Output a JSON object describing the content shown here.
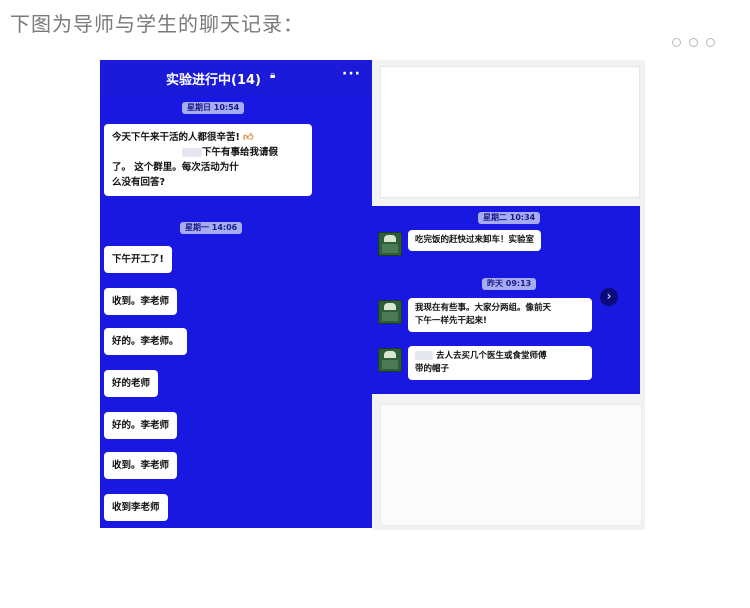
{
  "caption": "下图为导师与学生的聊天记录：",
  "left_chat": {
    "title": "实验进行中(14)",
    "lock_icon": "lock-icon",
    "more_icon": "more-dots-icon",
    "messages": [
      {
        "type": "time",
        "text": "星期日 10:54"
      },
      {
        "type": "text",
        "lines": [
          "今天下午来干活的人都很辛苦!",
          "下午有事给我请假",
          "了。 这个群里。每次活动为什",
          "么没有回答?"
        ]
      },
      {
        "type": "time",
        "text": "星期一 14:06"
      },
      {
        "type": "text",
        "text": "下午开工了!"
      },
      {
        "type": "text",
        "text": "收到。李老师"
      },
      {
        "type": "text",
        "text": "好的。李老师。"
      },
      {
        "type": "text",
        "text": "好的老师"
      },
      {
        "type": "text",
        "text": "好的。李老师"
      },
      {
        "type": "text",
        "text": "收到。李老师"
      },
      {
        "type": "text",
        "text": "收到李老师"
      }
    ]
  },
  "right_chat": {
    "messages": [
      {
        "type": "time",
        "text": "星期二 10:34"
      },
      {
        "type": "text",
        "text": "吃完饭的赶快过来卸车！实验室"
      },
      {
        "type": "time",
        "text": "昨天 09:13"
      },
      {
        "type": "text",
        "lines": [
          "我现在有些事。大家分两组。像前天",
          "下午一样先干起来!"
        ]
      },
      {
        "type": "text",
        "lines": [
          "去人去买几个医生或食堂师傅",
          "带的帽子"
        ]
      }
    ],
    "arrow_icon": "chevron-right-icon"
  },
  "colors": {
    "chat_blue": "#1818e0",
    "bubble": "#ffffff",
    "time_pill": "#a6acf2",
    "caption": "#7a7a7a"
  }
}
